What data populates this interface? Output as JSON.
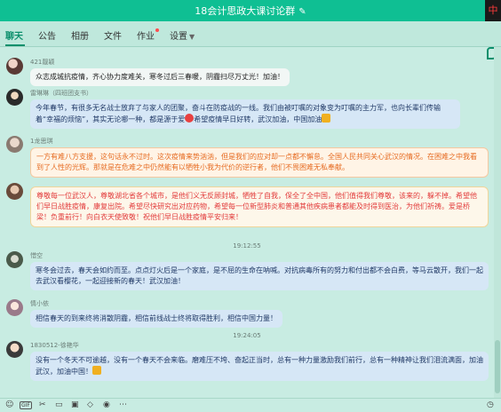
{
  "window": {
    "title": "18会计思政大课讨论群",
    "corner_mark": "中"
  },
  "tabs": [
    {
      "label": "聊天"
    },
    {
      "label": "公告"
    },
    {
      "label": "相册"
    },
    {
      "label": "文件"
    },
    {
      "label": "作业"
    },
    {
      "label": "设置"
    }
  ],
  "messages": [
    {
      "sender": "421靓颖",
      "text": "众志成城抗疫情，齐心协力度难关，寒冬过后三春暖，阴霾扫尽万丈光！加油！"
    },
    {
      "sender": "雷琳琳（四班团支书）",
      "text_a": "今年春节，有很多无名战士放弃了与家人的团聚，奋斗在防疫战的一线。我们由被叮嘱的对象变为叮嘱的主力军，也向长辈们传输着“幸福的烦恼”，其实无论哪一种，都是源于爱",
      "text_b": "希望疫情早日好转，武汉加油，中国加油"
    },
    {
      "sender": "1龙思琪",
      "text": "一方有难八方支援，这句话永不过时。这次疫情来势汹汹，但是我们的应对却一点都不懈怠。全国人民共同关心武汉的情况。在困难之中我看到了人性的光辉。那就是在危难之中仍然能有以牺牲小我为代价的逆行者，他们不畏困难无私奉献。"
    },
    {
      "sender": "",
      "text": "尊敬每一位武汉人，尊敬湖北省各个城市，是他们义无反顾封城，牺牲了自我，保全了全中国，他们值得我们尊敬，该来的，躲不掉。希望他们早日战胜疫情，康复出院。希望尽快研究出对应药物，希望每一位新型肺炎和普通其他疾病患者都能及时得到医治，为他们祈祷。爱是桥梁！负重前行！向白衣天使致敬！祝他们早日战胜疫情平安归来！"
    },
    {
      "time": "19:12:55"
    },
    {
      "sender": "惜空",
      "text": "寒冬会过去，春天会如约而至。点点灯火后是一个家庭，是不屈的生命在呐喊。对抗病毒所有的努力和付出都不会白费，等马云散开，我们一起去武汉看樱花，一起迎接新的春天！武汉加油！"
    },
    {
      "sender": "情小依",
      "text": "相信春天的到来终将消散阴霾，相信前线战士终将取得胜利，相信中国力量！"
    },
    {
      "time": "19:24:05"
    },
    {
      "sender": "1830512-徐艳华",
      "text": "没有一个冬天不可逾越，没有一个春天不会来临。磨难压不垮、奋起正当时，总有一种力量激励我们前行，总有一种精神让我们泪流满面，加油武汉，加油中国！"
    }
  ],
  "toolbar": {
    "gif_label": "GIF"
  },
  "colors": {
    "accent": "#0fbf93",
    "tab_active": "#0c8f6c",
    "bubble_orange": "#e66a20",
    "bubble_red": "#e23a3a"
  }
}
